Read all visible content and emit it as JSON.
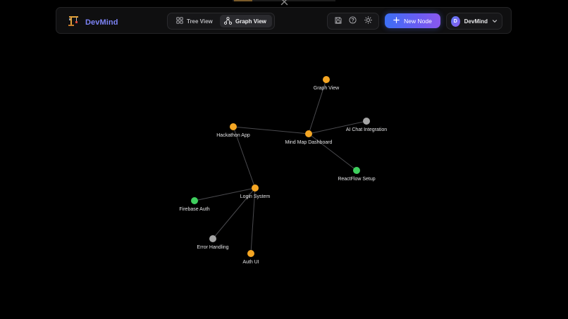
{
  "header": {
    "brand_title": "DevMind",
    "brand_icon": "crane-icon",
    "view_toggle": {
      "tree_label": "Tree View",
      "graph_label": "Graph View",
      "active": "graph"
    },
    "tools": [
      {
        "name": "save-icon"
      },
      {
        "name": "help-icon"
      },
      {
        "name": "sun-icon"
      }
    ],
    "new_node_label": "New Node",
    "user": {
      "initial": "D",
      "name": "DevMind"
    }
  },
  "colors": {
    "orange": "#f5a623",
    "green": "#3fcf5e",
    "gray": "#a5a5a5",
    "brand": "#7c83f5",
    "accent_start": "#3c6ff5",
    "accent_end": "#8a58ef"
  },
  "graph": {
    "nodes": [
      {
        "id": "graph-view",
        "label": "Graph View",
        "status": "orange"
      },
      {
        "id": "hackathon-app",
        "label": "Hackathon App",
        "status": "orange"
      },
      {
        "id": "mind-map-dashboard",
        "label": "Mind Map Dashboard",
        "status": "orange"
      },
      {
        "id": "ai-chat-integration",
        "label": "AI Chat Integration",
        "status": "gray"
      },
      {
        "id": "reactflow-setup",
        "label": "ReactFlow Setup",
        "status": "green"
      },
      {
        "id": "login-system",
        "label": "Login System",
        "status": "orange"
      },
      {
        "id": "firebase-auth",
        "label": "Firebase Auth",
        "status": "green"
      },
      {
        "id": "error-handling",
        "label": "Error Handling",
        "status": "gray"
      },
      {
        "id": "auth-ui",
        "label": "Auth UI",
        "status": "orange"
      }
    ],
    "edges": [
      [
        "mind-map-dashboard",
        "graph-view"
      ],
      [
        "mind-map-dashboard",
        "hackathon-app"
      ],
      [
        "mind-map-dashboard",
        "ai-chat-integration"
      ],
      [
        "mind-map-dashboard",
        "reactflow-setup"
      ],
      [
        "hackathon-app",
        "login-system"
      ],
      [
        "login-system",
        "firebase-auth"
      ],
      [
        "login-system",
        "error-handling"
      ],
      [
        "login-system",
        "auth-ui"
      ]
    ]
  }
}
